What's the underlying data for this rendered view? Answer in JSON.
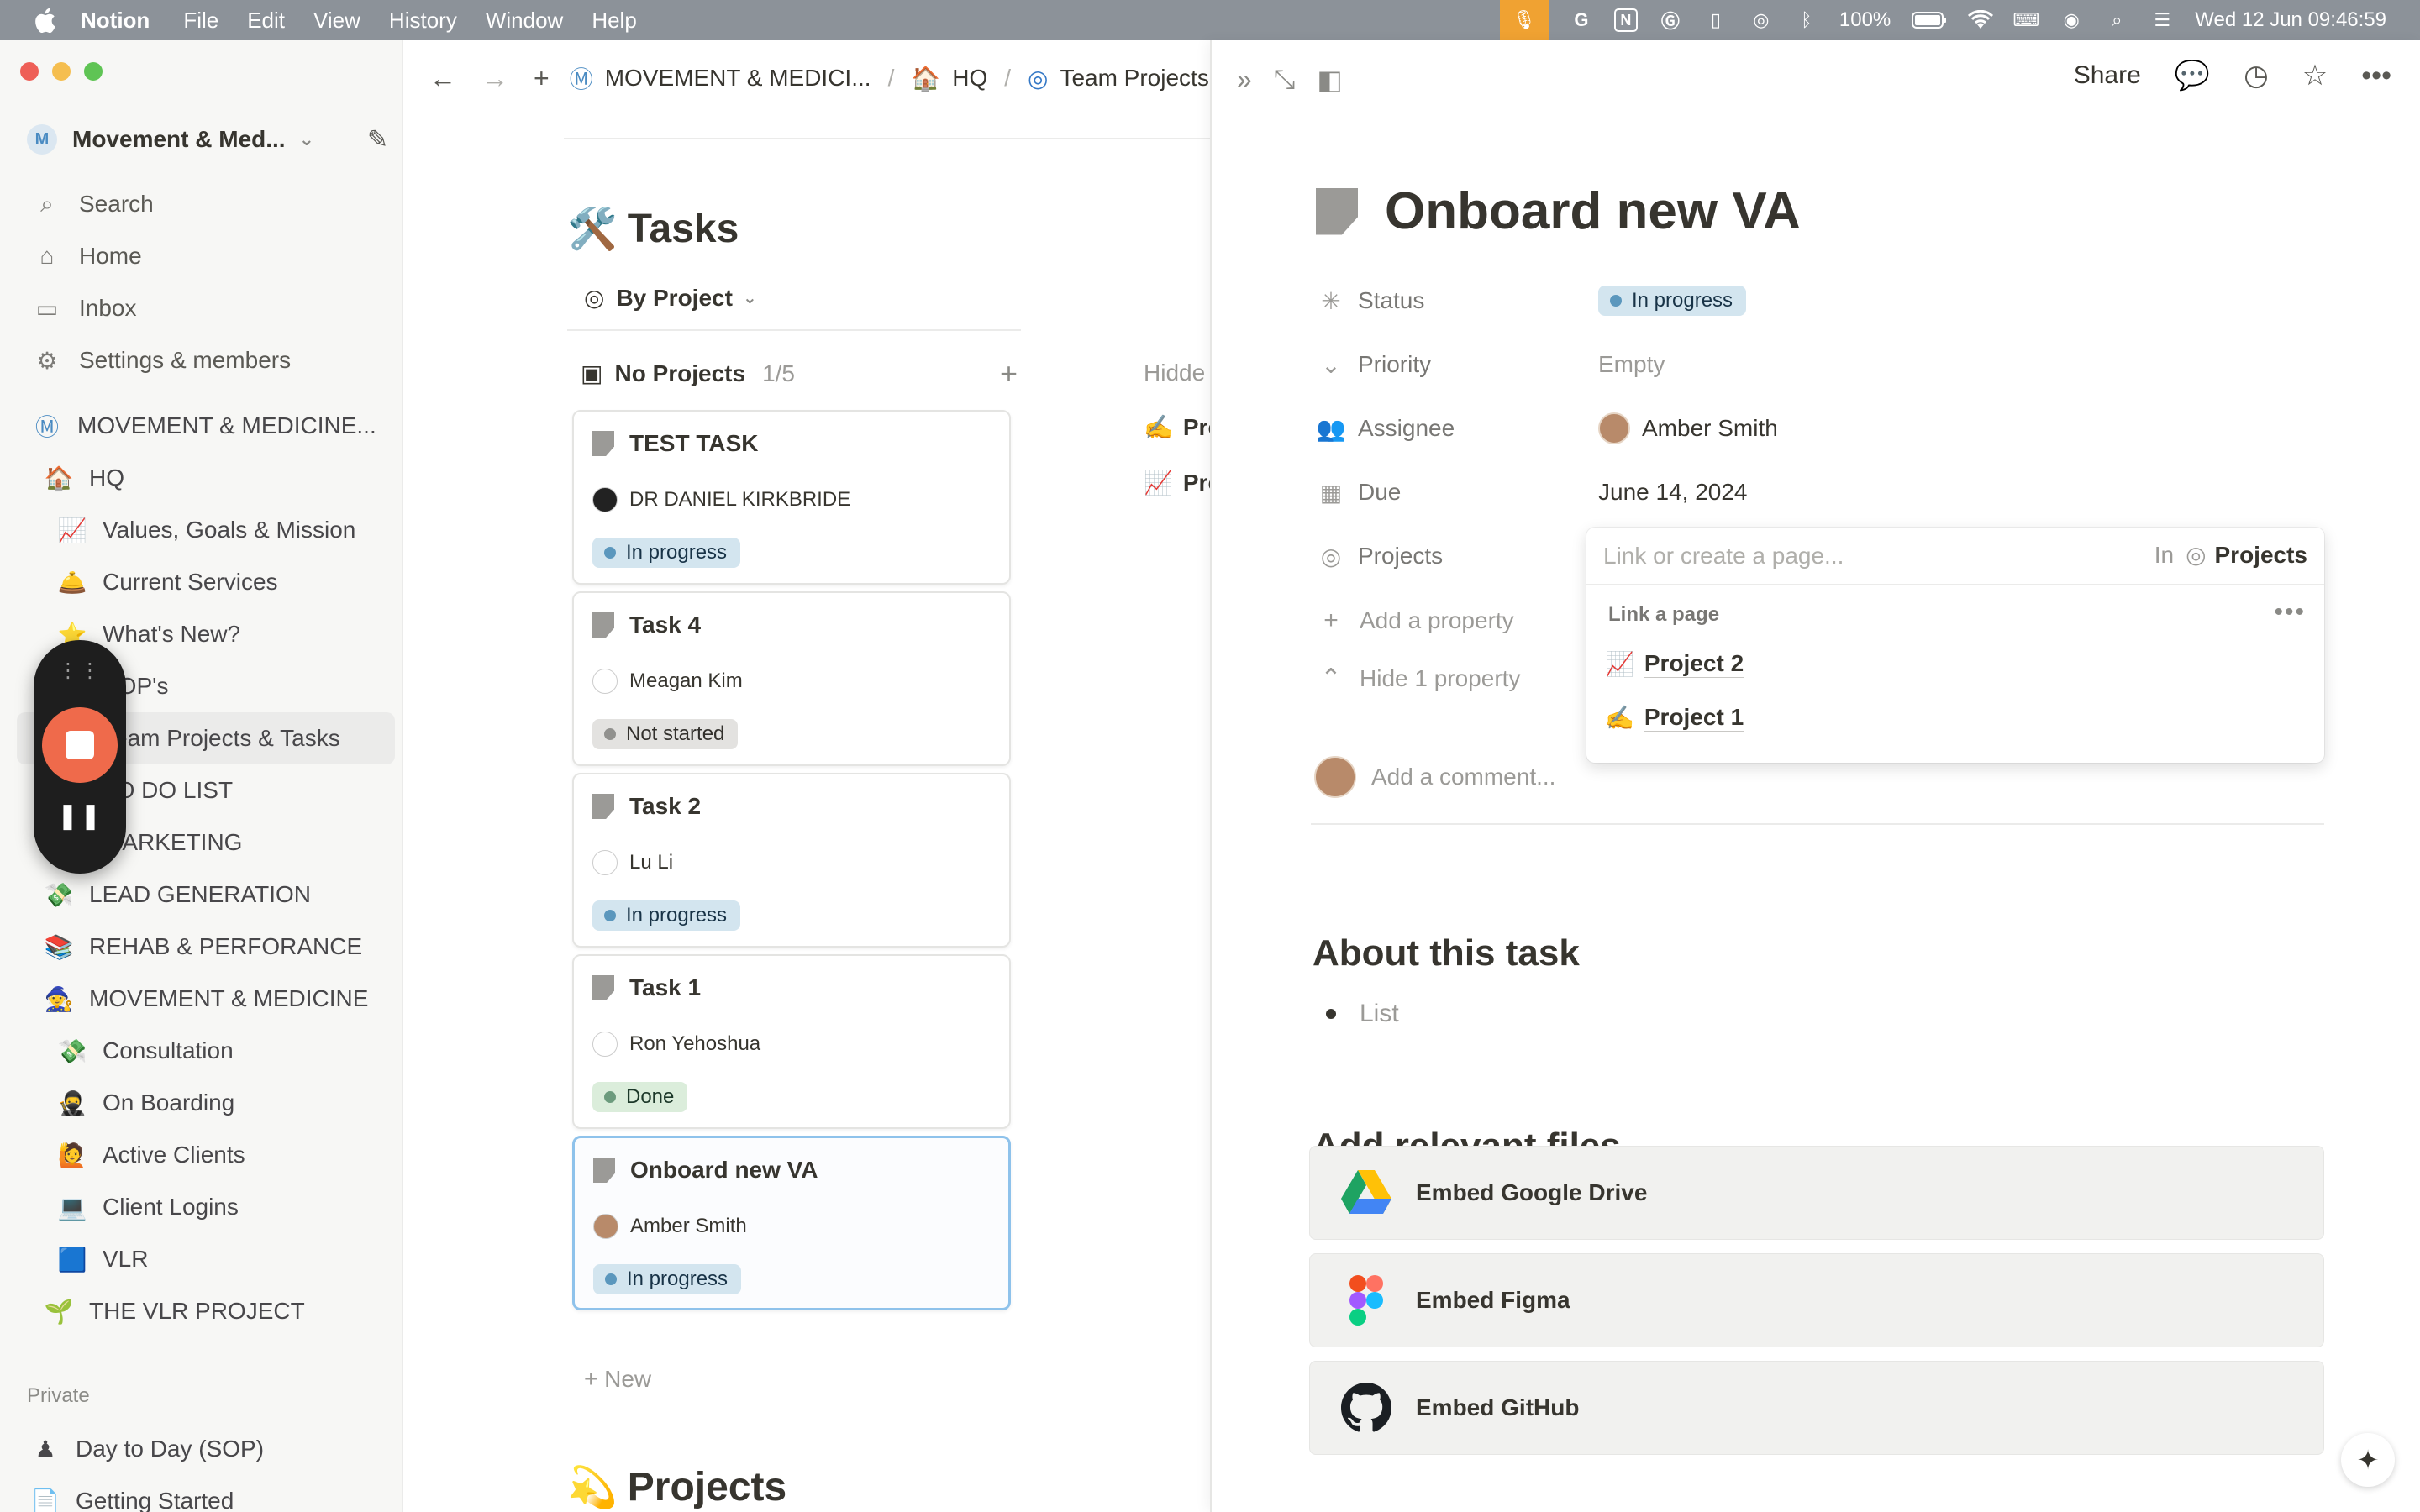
{
  "menubar": {
    "app": "Notion",
    "menus": [
      "File",
      "Edit",
      "View",
      "History",
      "Window",
      "Help"
    ],
    "battery": "100%",
    "datetime": "Wed 12 Jun  09:46:59"
  },
  "sidebar": {
    "workspace": "Movement & Med...",
    "nav": [
      {
        "label": "Search",
        "icon": "search-icon"
      },
      {
        "label": "Home",
        "icon": "home-icon"
      },
      {
        "label": "Inbox",
        "icon": "inbox-icon"
      },
      {
        "label": "Settings & members",
        "icon": "gear-icon"
      }
    ],
    "tree": [
      {
        "label": "MOVEMENT & MEDICINE...",
        "emoji": "Ⓜ",
        "indent": 0
      },
      {
        "label": "HQ",
        "emoji": "🏠",
        "indent": 1
      },
      {
        "label": "Values, Goals & Mission",
        "emoji": "📈",
        "indent": 2
      },
      {
        "label": "Current Services",
        "emoji": "🛎️",
        "indent": 2
      },
      {
        "label": "What's New?",
        "emoji": "⭐",
        "indent": 2
      },
      {
        "label": "SOP's",
        "emoji": "📄",
        "indent": 2
      },
      {
        "label": "Team Projects & Tasks",
        "emoji": "🎯",
        "indent": 2
      },
      {
        "label": "TO DO LIST",
        "emoji": "📝",
        "indent": 2
      },
      {
        "label": "MARKETING",
        "emoji": "📣",
        "indent": 2
      },
      {
        "label": "LEAD GENERATION",
        "emoji": "💸",
        "indent": 1
      },
      {
        "label": "REHAB & PERFORANCE",
        "emoji": "📚",
        "indent": 1
      },
      {
        "label": "MOVEMENT & MEDICINE",
        "emoji": "🧙",
        "indent": 1
      },
      {
        "label": "Consultation",
        "emoji": "💸",
        "indent": 2
      },
      {
        "label": "On Boarding",
        "emoji": "🥷",
        "indent": 2
      },
      {
        "label": "Active Clients",
        "emoji": "🙋",
        "indent": 2
      },
      {
        "label": "Client Logins",
        "emoji": "💻",
        "indent": 2
      },
      {
        "label": "VLR",
        "emoji": "🟦",
        "indent": 2
      },
      {
        "label": "THE VLR PROJECT",
        "emoji": "🌱",
        "indent": 1
      }
    ],
    "private_label": "Private",
    "private": [
      {
        "label": "Day to Day (SOP)",
        "emoji": "♟️"
      },
      {
        "label": "Getting Started",
        "emoji": "📄"
      }
    ]
  },
  "main": {
    "breadcrumbs": [
      {
        "label": "MOVEMENT & MEDICI...",
        "emoji": "Ⓜ"
      },
      {
        "label": "HQ",
        "emoji": "🏠"
      },
      {
        "label": "Team Projects",
        "emoji": "🎯"
      }
    ],
    "db_title": "Tasks",
    "db_emoji": "🛠️",
    "view": "By Project",
    "group": {
      "label": "No Projects",
      "count": "1/5"
    },
    "hidden_label": "Hidde",
    "hidden_rows": [
      {
        "emoji": "✍️",
        "label": "Pro"
      },
      {
        "emoji": "📈",
        "label": "Pro"
      }
    ],
    "cards": [
      {
        "title": "TEST TASK",
        "person": "DR DANIEL KIRKBRIDE",
        "status": "In progress",
        "kind": "inprog"
      },
      {
        "title": "Task 4",
        "person": "Meagan Kim",
        "status": "Not started",
        "kind": "notstart"
      },
      {
        "title": "Task 2",
        "person": "Lu Li",
        "status": "In progress",
        "kind": "inprog"
      },
      {
        "title": "Task 1",
        "person": "Ron Yehoshua",
        "status": "Done",
        "kind": "done"
      },
      {
        "title": "Onboard new VA",
        "person": "Amber Smith",
        "status": "In progress",
        "kind": "inprog"
      }
    ],
    "new_label": "+ New",
    "projects_title": "Projects",
    "projects_emoji": "💫"
  },
  "peek": {
    "share": "Share",
    "title": "Onboard new VA",
    "props": {
      "status_label": "Status",
      "status_value": "In progress",
      "priority_label": "Priority",
      "priority_value": "Empty",
      "assignee_label": "Assignee",
      "assignee_value": "Amber Smith",
      "due_label": "Due",
      "due_value": "June 14, 2024",
      "projects_label": "Projects"
    },
    "add_property": "Add a property",
    "hide_property": "Hide 1 property",
    "comment_placeholder": "Add a comment...",
    "about_heading": "About this task",
    "bullet": "List",
    "files_heading": "Add relevant files",
    "embeds": [
      "Embed Google Drive",
      "Embed Figma",
      "Embed GitHub"
    ]
  },
  "popover": {
    "placeholder": "Link or create a page...",
    "in_label": "In",
    "in_db": "Projects",
    "section": "Link a page",
    "items": [
      {
        "emoji": "📈",
        "label": "Project 2"
      },
      {
        "emoji": "✍️",
        "label": "Project 1"
      }
    ]
  }
}
